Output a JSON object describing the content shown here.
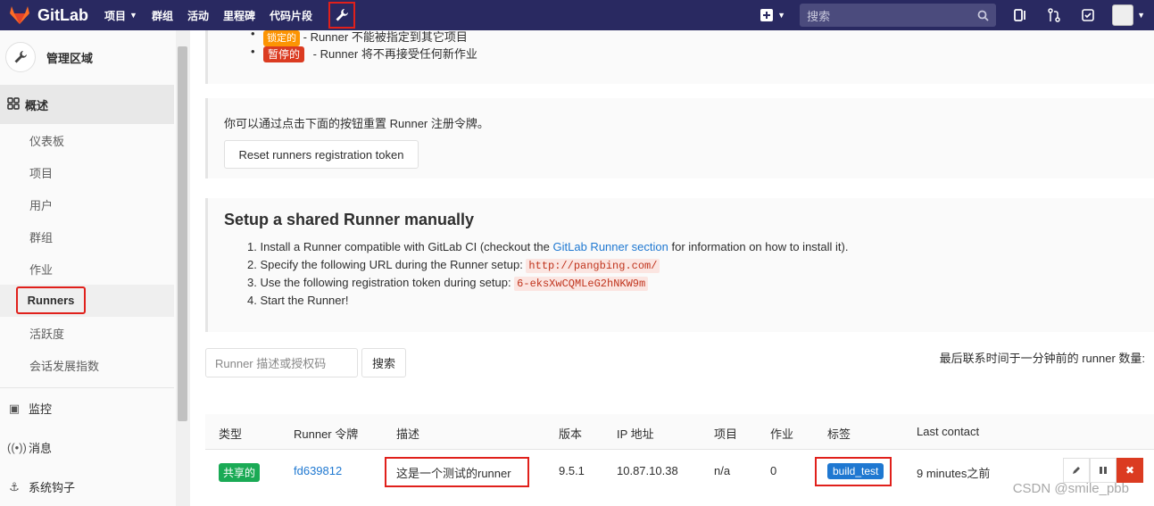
{
  "header": {
    "brand": "GitLab",
    "nav": [
      "项目",
      "群组",
      "活动",
      "里程碑",
      "代码片段"
    ],
    "search_placeholder": "搜索"
  },
  "sidebar": {
    "title": "管理区域",
    "active_section": "概述",
    "sub_items": [
      "仪表板",
      "项目",
      "用户",
      "群组",
      "作业",
      "Runners",
      "活跃度",
      "会话发展指数"
    ],
    "sections": [
      "监控",
      "消息",
      "系统钩子"
    ]
  },
  "info1": {
    "locked_badge": "锁定的",
    "locked_text": "- Runner 不能被指定到其它项目",
    "paused_badge": "暂停的",
    "paused_text": "- Runner 将不再接受任何新作业"
  },
  "info2": {
    "text": "你可以通过点击下面的按钮重置 Runner 注册令牌。",
    "button": "Reset runners registration token"
  },
  "setup": {
    "title": "Setup a shared Runner manually",
    "step1_pre": "1. Install a Runner compatible with GitLab CI (checkout the ",
    "step1_link": "GitLab Runner section",
    "step1_post": " for information on how to install it).",
    "step2": "2. Specify the following URL during the Runner setup: ",
    "url": "http://pangbing.com/",
    "step3": "3. Use the following registration token during setup: ",
    "token": "6-eksXwCQMLeG2hNKW9m",
    "step4": "4. Start the Runner!"
  },
  "filter": {
    "placeholder": "Runner 描述或授权码",
    "search_button": "搜索",
    "count_text": "最后联系时间于一分钟前的 runner 数量:"
  },
  "table": {
    "headers": [
      "类型",
      "Runner 令牌",
      "描述",
      "版本",
      "IP 地址",
      "项目",
      "作业",
      "标签",
      "Last contact"
    ],
    "row": {
      "type": "共享的",
      "token": "fd639812",
      "description": "这是一个测试的runner",
      "version": "9.5.1",
      "ip": "10.87.10.38",
      "projects": "n/a",
      "jobs": "0",
      "tag": "build_test",
      "last_contact": "9 minutes之前"
    }
  },
  "watermark": "CSDN @smile_pbb",
  "colors": {
    "nav_bg": "#292961",
    "accent_red": "#e0201b",
    "link": "#1f78d1",
    "green": "#1aaa55"
  }
}
